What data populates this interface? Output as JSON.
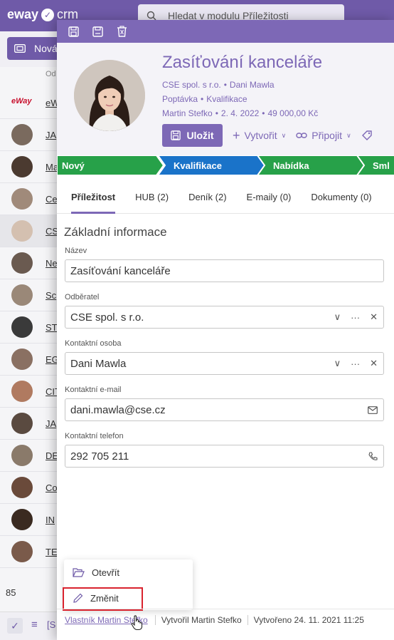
{
  "app": {
    "logo_text": "eway",
    "logo_suffix": "crm",
    "search_placeholder": "Hledat v modulu Příležitosti",
    "new_button": "Nová",
    "list_column_header": "Od",
    "record_count": "85",
    "list_rows": [
      {
        "text": "eW"
      },
      {
        "text": "JA"
      },
      {
        "text": "Ma"
      },
      {
        "text": "Ce"
      },
      {
        "text": "CS"
      },
      {
        "text": "Ne"
      },
      {
        "text": "Sc"
      },
      {
        "text": "ST"
      },
      {
        "text": "EG"
      },
      {
        "text": "CIT"
      },
      {
        "text": "JA"
      },
      {
        "text": "DE"
      },
      {
        "text": "Co"
      },
      {
        "text": "IN"
      },
      {
        "text": "TE"
      }
    ],
    "list_logo_text": "eWay",
    "footer_bracket": "[S"
  },
  "record": {
    "title": "Zasíťování kanceláře",
    "meta_line1": [
      "CSE spol. s r.o.",
      "Dani Mawla"
    ],
    "meta_line2": [
      "Poptávka",
      "Kvalifikace"
    ],
    "meta_line3": [
      "Martin Stefko",
      "2. 4. 2022",
      "49 000,00 Kč"
    ],
    "save_label": "Uložit",
    "create_label": "Vytvořit",
    "connect_label": "Připojit"
  },
  "stages": [
    "Nový",
    "Kvalifikace",
    "Nabídka",
    "Sml"
  ],
  "stage_colors": [
    "#27a149",
    "#1a73c9",
    "#27a149",
    "#27a149"
  ],
  "tabs": [
    {
      "label": "Příležitost",
      "active": true
    },
    {
      "label": "HUB (2)"
    },
    {
      "label": "Deník (2)"
    },
    {
      "label": "E-maily (0)"
    },
    {
      "label": "Dokumenty (0)"
    }
  ],
  "section_title": "Základní informace",
  "fields": {
    "name": {
      "label": "Název",
      "value": "Zasíťování kanceláře"
    },
    "customer": {
      "label": "Odběratel",
      "value": "CSE spol. s r.o."
    },
    "contact": {
      "label": "Kontaktní osoba",
      "value": "Dani Mawla"
    },
    "email": {
      "label": "Kontaktní e-mail",
      "value": "dani.mawla@cse.cz"
    },
    "phone": {
      "label": "Kontaktní telefon",
      "value": "292 705 211"
    }
  },
  "popup": {
    "open_label": "Otevřít",
    "change_label": "Změnit"
  },
  "footer": {
    "owner": "Vlastník Martin Stefko",
    "created_by": "Vytvořil Martin Stefko",
    "created_at": "Vytvořeno 24. 11. 2021 11:25"
  },
  "colors": {
    "brand": "#7d68b6",
    "stage_green": "#27a149",
    "stage_blue": "#1a73c9",
    "highlight": "#d9232e"
  }
}
